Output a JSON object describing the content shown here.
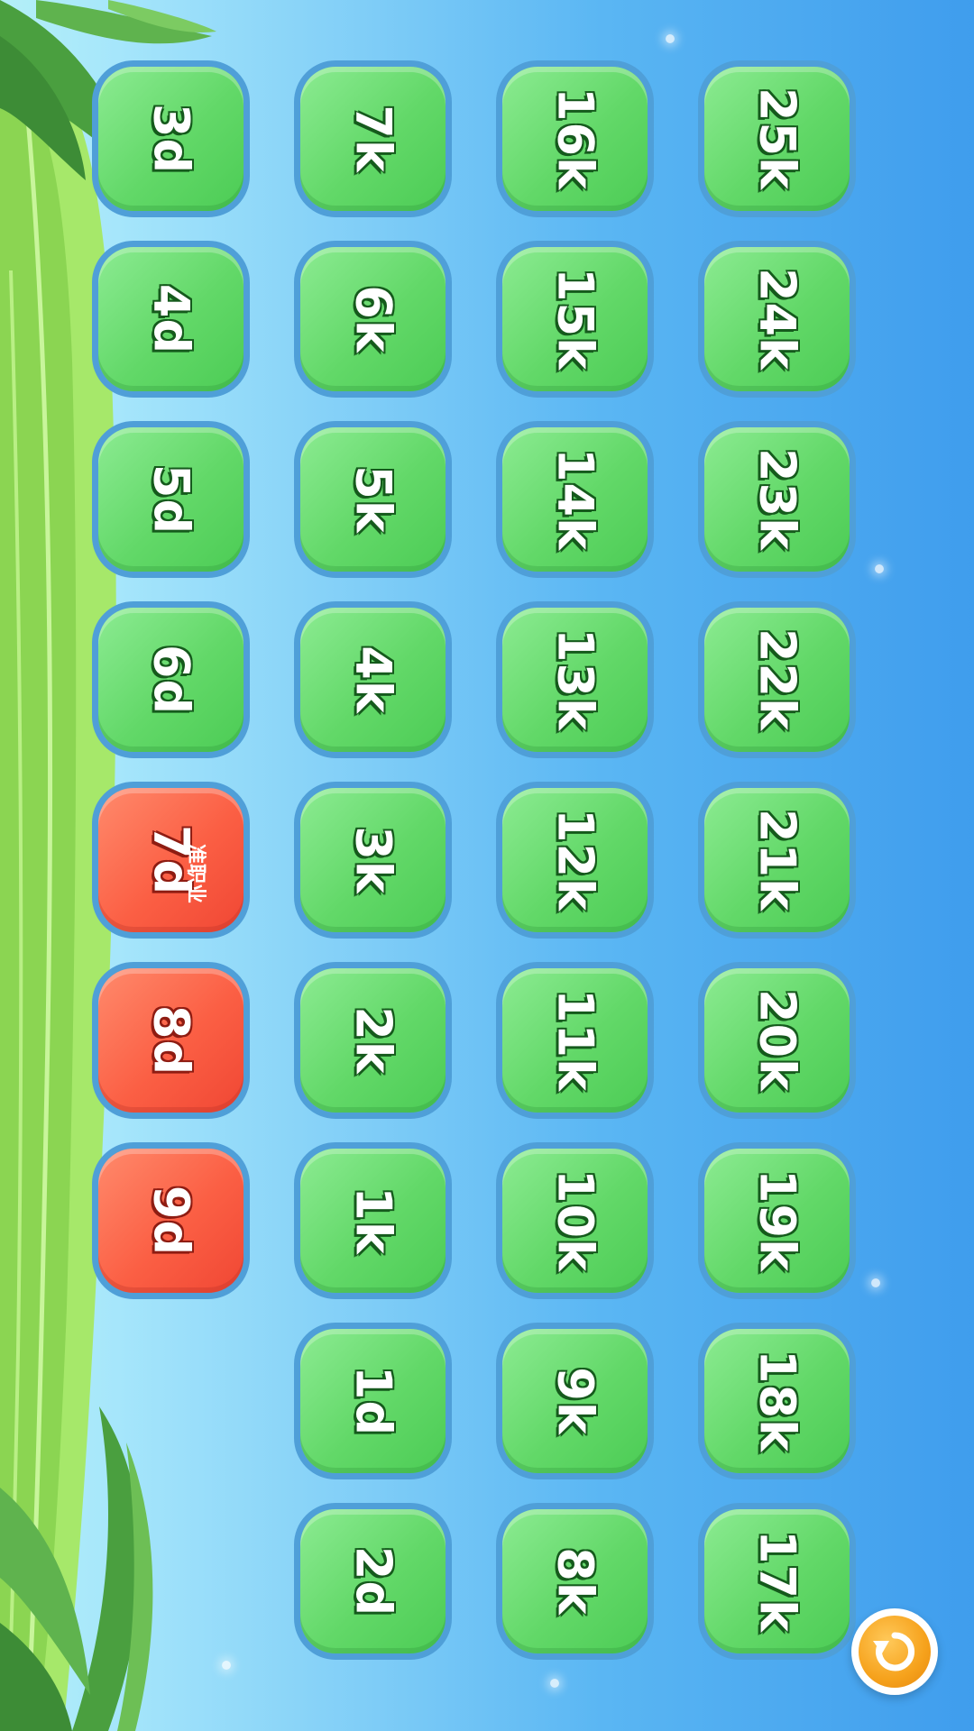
{
  "levels": [
    {
      "label": "3d",
      "color": "green"
    },
    {
      "label": "4d",
      "color": "green"
    },
    {
      "label": "5d",
      "color": "green"
    },
    {
      "label": "6d",
      "color": "green"
    },
    {
      "label": "7d",
      "color": "red",
      "sub": "准职业"
    },
    {
      "label": "8d",
      "color": "red"
    },
    {
      "label": "9d",
      "color": "red"
    },
    {
      "label": "7k",
      "color": "green"
    },
    {
      "label": "6k",
      "color": "green"
    },
    {
      "label": "5k",
      "color": "green"
    },
    {
      "label": "4k",
      "color": "green"
    },
    {
      "label": "3k",
      "color": "green"
    },
    {
      "label": "2k",
      "color": "green"
    },
    {
      "label": "1k",
      "color": "green"
    },
    {
      "label": "1d",
      "color": "green"
    },
    {
      "label": "2d",
      "color": "green"
    },
    {
      "label": "16k",
      "color": "green"
    },
    {
      "label": "15k",
      "color": "green"
    },
    {
      "label": "14k",
      "color": "green"
    },
    {
      "label": "13k",
      "color": "green"
    },
    {
      "label": "12k",
      "color": "green"
    },
    {
      "label": "11k",
      "color": "green"
    },
    {
      "label": "10k",
      "color": "green"
    },
    {
      "label": "9k",
      "color": "green"
    },
    {
      "label": "8k",
      "color": "green"
    },
    {
      "label": "25k",
      "color": "green"
    },
    {
      "label": "24k",
      "color": "green"
    },
    {
      "label": "23k",
      "color": "green"
    },
    {
      "label": "22k",
      "color": "green"
    },
    {
      "label": "21k",
      "color": "green"
    },
    {
      "label": "20k",
      "color": "green"
    },
    {
      "label": "19k",
      "color": "green"
    },
    {
      "label": "18k",
      "color": "green"
    },
    {
      "label": "17k",
      "color": "green"
    }
  ],
  "colors": {
    "green_button": "#5ad663",
    "red_button": "#f75a40",
    "button_border": "#4f9fd8",
    "reset_button": "#f6a21c"
  },
  "reset_button": {
    "icon": "refresh-icon"
  }
}
